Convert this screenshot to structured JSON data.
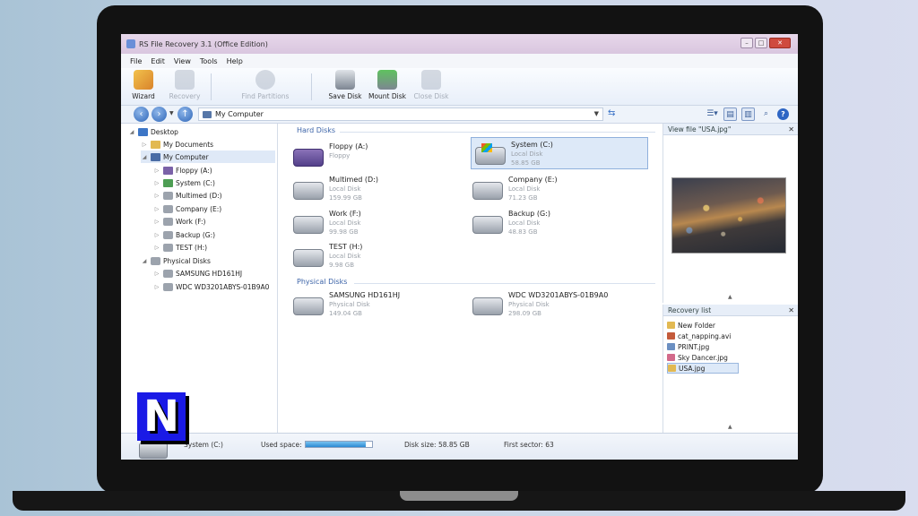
{
  "window": {
    "title": "RS File Recovery 3.1 (Office Edition)"
  },
  "menu": [
    "File",
    "Edit",
    "View",
    "Tools",
    "Help"
  ],
  "toolbar": {
    "wizard": "Wizard",
    "recovery": "Recovery",
    "find_partitions": "Find Partitions",
    "save_disk": "Save Disk",
    "mount_disk": "Mount Disk",
    "close_disk": "Close Disk"
  },
  "address": {
    "path": "My Computer"
  },
  "tree": {
    "desktop": "Desktop",
    "my_documents": "My Documents",
    "my_computer": "My Computer",
    "drives": [
      "Floppy (A:)",
      "System (C:)",
      "Multimed (D:)",
      "Company (E:)",
      "Work (F:)",
      "Backup (G:)",
      "TEST (H:)"
    ],
    "physical_disks": "Physical Disks",
    "physical": [
      "SAMSUNG HD161HJ",
      "WDC WD3201ABYS-01B9A0"
    ]
  },
  "main": {
    "hard_disks_header": "Hard Disks",
    "physical_disks_header": "Physical Disks",
    "hard_disks": [
      {
        "name": "Floppy (A:)",
        "type": "Floppy",
        "size": ""
      },
      {
        "name": "System (C:)",
        "type": "Local Disk",
        "size": "58.85 GB"
      },
      {
        "name": "Multimed (D:)",
        "type": "Local Disk",
        "size": "159.99 GB"
      },
      {
        "name": "Company (E:)",
        "type": "Local Disk",
        "size": "71.23 GB"
      },
      {
        "name": "Work (F:)",
        "type": "Local Disk",
        "size": "99.98 GB"
      },
      {
        "name": "Backup (G:)",
        "type": "Local Disk",
        "size": "48.83 GB"
      },
      {
        "name": "TEST (H:)",
        "type": "Local Disk",
        "size": "9.98 GB"
      }
    ],
    "physical_disks": [
      {
        "name": "SAMSUNG HD161HJ",
        "type": "Physical Disk",
        "size": "149.04 GB"
      },
      {
        "name": "WDC WD3201ABYS-01B9A0",
        "type": "Physical Disk",
        "size": "298.09 GB"
      }
    ]
  },
  "view_file": {
    "title": "View file \"USA.jpg\""
  },
  "recovery_list": {
    "title": "Recovery list",
    "items": [
      "New Folder",
      "cat_napping.avi",
      "PRINT.jpg",
      "Sky Dancer.jpg",
      "USA.jpg"
    ]
  },
  "status": {
    "disk_name": "System (C:)",
    "used_label": "Used space:",
    "used_fraction": 0.9,
    "disk_size": "Disk size: 58.85 GB",
    "first_sector": "First sector: 63"
  },
  "logo": {
    "letter": "N"
  }
}
